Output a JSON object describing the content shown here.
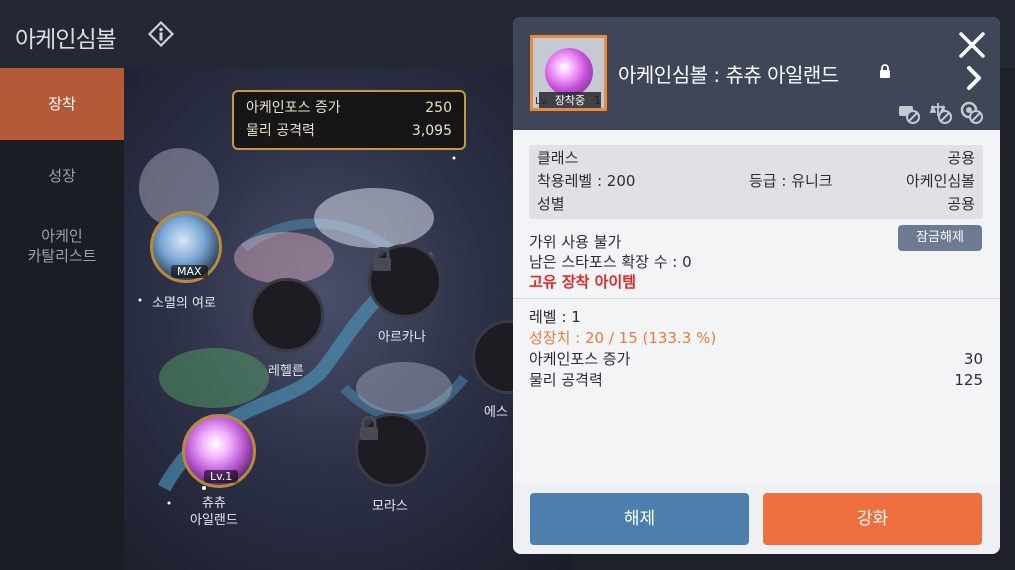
{
  "header": {
    "title": "아케인심볼"
  },
  "tabs": [
    {
      "label": "장착"
    },
    {
      "label": "성장"
    },
    {
      "label": "아케인\n카탈리스트"
    }
  ],
  "map": {
    "stats": [
      {
        "label": "아케인포스 증가",
        "value": "250"
      },
      {
        "label": "물리 공격력",
        "value": "3,095"
      }
    ],
    "nodes": {
      "vanishing": {
        "label": "소멸의 여로",
        "badge": "MAX"
      },
      "reheln": {
        "label": "레헬른"
      },
      "arcana": {
        "label": "아르카나"
      },
      "esfera": {
        "label": "에스"
      },
      "chuchu": {
        "label": "츄츄\n아일랜드",
        "badge": "Lv.1"
      },
      "morass": {
        "label": "모라스"
      }
    }
  },
  "panel": {
    "item_name": "아케인심볼 : 츄츄 아일랜드",
    "thumb": {
      "lv_prefix": "Lv.",
      "level": "1",
      "equipped": "장착중"
    },
    "info": {
      "class_label": "클래스",
      "class_value": "공용",
      "level_label": "착용레벨 : 200",
      "grade_label": "등급 : 유니크",
      "type_value": "아케인심볼",
      "gender_label": "성별",
      "gender_value": "공용"
    },
    "restrictions": {
      "scissors": "가위 사용 불가",
      "starforce": "남은 스타포스 확장 수 : 0",
      "unique": "고유 장착 아이템"
    },
    "unlock_button": "잠금해제",
    "growth": {
      "level": "레벨 : 1",
      "exp": "성장치 : 20 / 15 (133.3 %)",
      "force_label": "아케인포스 증가",
      "force_value": "30",
      "atk_label": "물리 공격력",
      "atk_value": "125"
    },
    "buttons": {
      "release": "해제",
      "enhance": "강화"
    }
  }
}
